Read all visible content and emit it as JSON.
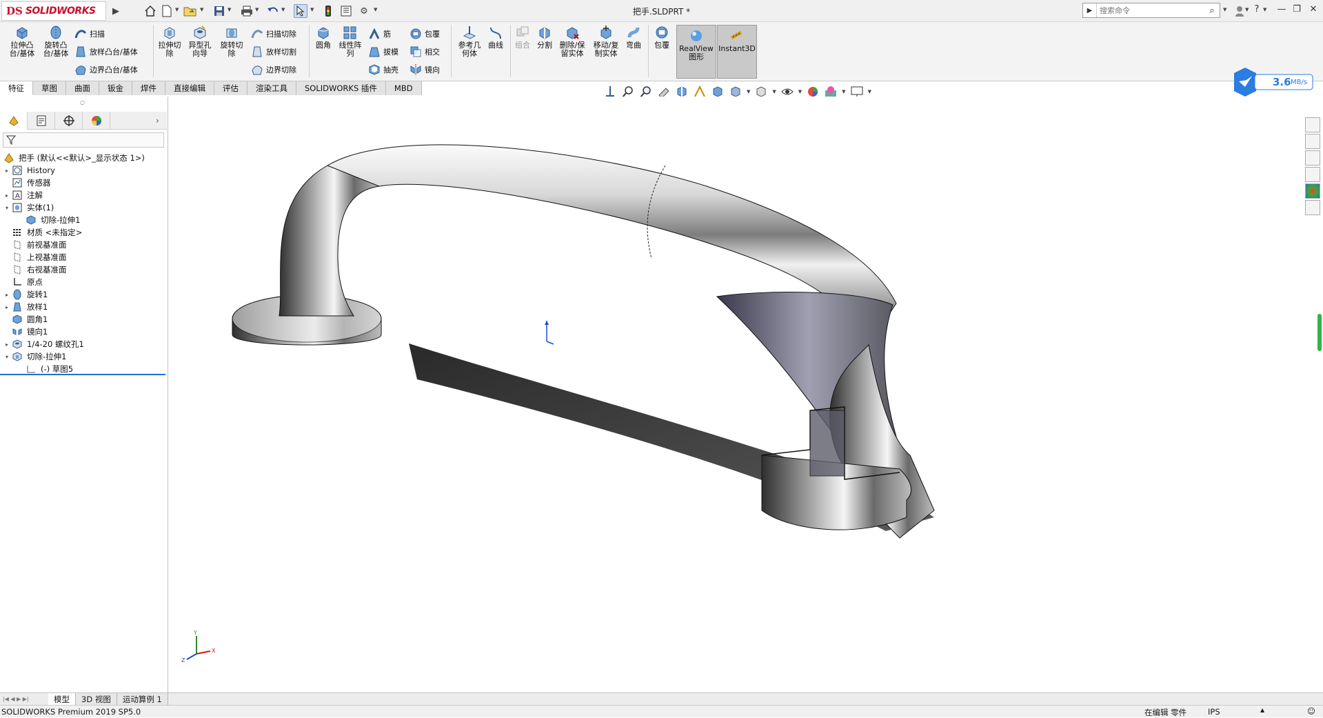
{
  "app": {
    "logo_ds": "DS",
    "logo_name": "SOLIDWORKS",
    "document_title": "把手.SLDPRT *"
  },
  "search": {
    "placeholder": "搜索命令"
  },
  "window_controls": [
    "?",
    "—",
    "❐",
    "✕"
  ],
  "ribbon": {
    "extrude_boss": "拉伸凸\n台/基体",
    "revolve_boss": "旋转凸\n台/基体",
    "sweep": "扫描",
    "loft_boss": "放样凸台/基体",
    "boundary_boss": "边界凸台/基体",
    "extrude_cut": "拉伸切\n除",
    "hole_wizard": "异型孔\n向导",
    "revolve_cut": "旋转切\n除",
    "sweep_cut": "扫描切除",
    "loft_cut": "放样切割",
    "boundary_cut": "边界切除",
    "fillet": "圆角",
    "linear_pattern": "线性阵\n列",
    "rib": "筋",
    "draft": "拔模",
    "shell": "抽壳",
    "wrap": "包覆",
    "intersect": "相交",
    "mirror": "镜向",
    "ref_geometry": "参考几\n何体",
    "curves": "曲线",
    "combine": "组合",
    "split": "分割",
    "delete_keep": "删除/保\n留实体",
    "move_copy": "移动/复\n制实体",
    "flex": "弯曲",
    "wrap2": "包覆",
    "realview": "RealView\n图形",
    "instant3d": "Instant3D"
  },
  "command_tabs": [
    "特征",
    "草图",
    "曲面",
    "钣金",
    "焊件",
    "直接编辑",
    "评估",
    "渲染工具",
    "SOLIDWORKS 插件",
    "MBD"
  ],
  "active_command_tab": "特征",
  "speed_widget": {
    "value": "3.6",
    "unit": "MB/s"
  },
  "tree": {
    "root": "把手  (默认<<默认>_显示状态 1>)",
    "items": [
      {
        "label": "History",
        "arrow": "▸",
        "icon": "history"
      },
      {
        "label": "传感器",
        "arrow": "",
        "icon": "sensor"
      },
      {
        "label": "注解",
        "arrow": "▸",
        "icon": "annotation"
      },
      {
        "label": "实体(1)",
        "arrow": "▾",
        "icon": "solid-bodies"
      },
      {
        "label": "切除-拉伸1",
        "arrow": "",
        "icon": "body",
        "indent": 1
      },
      {
        "label": "材质 <未指定>",
        "arrow": "",
        "icon": "material"
      },
      {
        "label": "前视基准面",
        "arrow": "",
        "icon": "plane"
      },
      {
        "label": "上视基准面",
        "arrow": "",
        "icon": "plane"
      },
      {
        "label": "右视基准面",
        "arrow": "",
        "icon": "plane"
      },
      {
        "label": "原点",
        "arrow": "",
        "icon": "origin"
      },
      {
        "label": "旋转1",
        "arrow": "▸",
        "icon": "revolve"
      },
      {
        "label": "放样1",
        "arrow": "▸",
        "icon": "loft"
      },
      {
        "label": "圆角1",
        "arrow": "",
        "icon": "fillet"
      },
      {
        "label": "镜向1",
        "arrow": "",
        "icon": "mirror"
      },
      {
        "label": "1/4-20 螺纹孔1",
        "arrow": "▸",
        "icon": "hole"
      },
      {
        "label": "切除-拉伸1",
        "arrow": "▾",
        "icon": "cut-extrude"
      },
      {
        "label": "(-) 草图5",
        "arrow": "",
        "icon": "sketch",
        "indent": 1
      }
    ]
  },
  "bottom_tabs": [
    "模型",
    "3D 视图",
    "运动算例 1"
  ],
  "active_bottom_tab": "模型",
  "status": {
    "left": "SOLIDWORKS Premium 2019 SP5.0",
    "mode": "在编辑 零件",
    "units": "IPS"
  },
  "colors": {
    "accent_red": "#c8102e",
    "selection_blue": "#1e6fd9",
    "speed_blue": "#2a7de1"
  }
}
